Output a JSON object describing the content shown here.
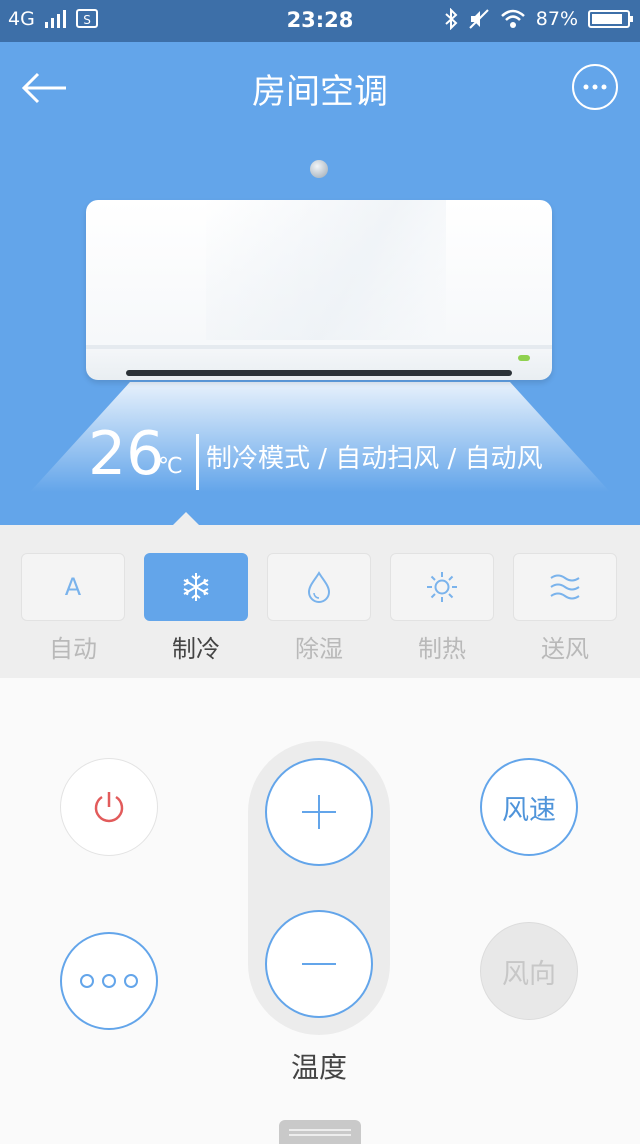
{
  "status_bar": {
    "network": "4G",
    "time": "23:28",
    "battery_text": "87%",
    "battery_level": 0.87
  },
  "header": {
    "title": "房间空调"
  },
  "display": {
    "temperature": "26",
    "unit": "℃",
    "mode_text": "制冷模式 / 自动扫风 / 自动风"
  },
  "modes": [
    {
      "label": "自动",
      "icon": "auto-icon",
      "active": false
    },
    {
      "label": "制冷",
      "icon": "snowflake-icon",
      "active": true
    },
    {
      "label": "除湿",
      "icon": "droplet-icon",
      "active": false
    },
    {
      "label": "制热",
      "icon": "sun-icon",
      "active": false
    },
    {
      "label": "送风",
      "icon": "wind-icon",
      "active": false
    }
  ],
  "auto_icon_glyph": "A",
  "controls": {
    "fan_speed_label": "风速",
    "fan_direction_label": "风向",
    "temperature_label": "温度"
  },
  "colors": {
    "accent": "#63a5ea",
    "power_icon": "#e25b5b",
    "status_bar": "#3d6fa8"
  }
}
